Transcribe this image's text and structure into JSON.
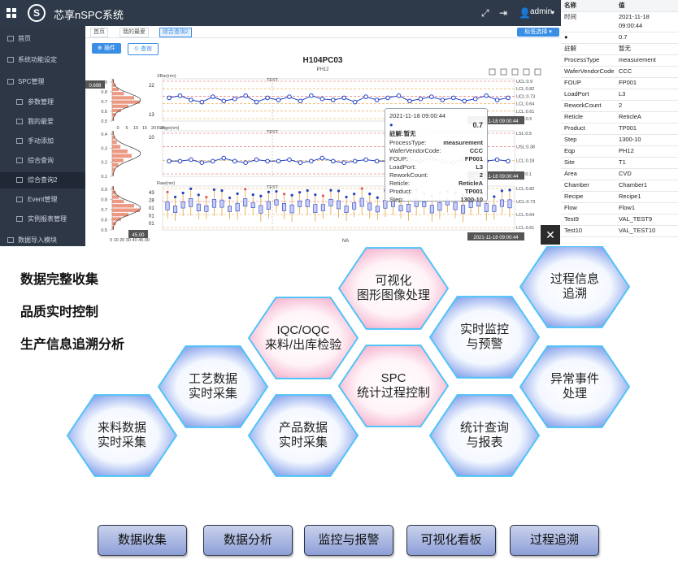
{
  "app": {
    "title": "芯享nSPC系统",
    "user": "admin"
  },
  "sidebar": {
    "items": [
      "首页",
      "系统功能设定",
      "SPC管理",
      "参数管理",
      "我的最爱",
      "手动添加",
      "综合查询",
      "综合查询2",
      "Event管理",
      "实例报表管理",
      "数据导入模块"
    ]
  },
  "tabs": [
    "首页",
    "我的最爱",
    "综合查询2"
  ],
  "tab_select": "标签选择",
  "toolbar": {
    "btn1": "插件",
    "btn2": "查询"
  },
  "chart": {
    "title": "H104PC03",
    "subtitle": "PH12",
    "panels": [
      {
        "ylabel": "XBar(nm)",
        "section": "TEST",
        "ymax": "0.9",
        "ylabels": [
          "0.9",
          "0.8",
          "0.7",
          "0.6",
          "0.5"
        ],
        "hist_labels": [
          "22",
          "13"
        ],
        "limits": [
          "UCL:0.9",
          "LCL:0.82",
          "UCL:0.73",
          "LCL:0.64",
          "LCL:0.61",
          "LCL:0.5"
        ],
        "current": "0.698",
        "values": [
          0.72,
          0.74,
          0.7,
          0.68,
          0.73,
          0.69,
          0.71,
          0.74,
          0.68,
          0.72,
          0.7,
          0.73,
          0.69,
          0.74,
          0.71,
          0.7,
          0.72,
          0.68,
          0.73,
          0.7,
          0.72,
          0.74,
          0.69,
          0.71,
          0.73,
          0.7,
          0.72,
          0.69,
          0.71,
          0.74,
          0.7,
          0.72
        ]
      },
      {
        "ylabel": "Range(nm)",
        "section": "TEST",
        "ylabels": [
          "0.4",
          "0.3",
          "0.2",
          "0.1"
        ],
        "hist_labels": [
          "10"
        ],
        "limits": [
          "LSL:0.5",
          "USL:0.38",
          "LCL:0.18",
          "LSL:0.1"
        ],
        "current": "",
        "values": [
          0.2,
          0.2,
          0.21,
          0.19,
          0.2,
          0.22,
          0.2,
          0.19,
          0.21,
          0.2,
          0.2,
          0.21,
          0.19,
          0.2,
          0.22,
          0.2,
          0.19,
          0.2,
          0.21,
          0.2,
          0.2,
          0.19,
          0.21,
          0.2,
          0.22,
          0.2,
          0.19,
          0.21,
          0.2,
          0.2,
          0.21,
          0.2
        ]
      },
      {
        "ylabel": "Raw(nm)",
        "section": "TEST",
        "ylabels": [
          "0.9",
          "0.8",
          "0.7",
          "0.6",
          "0.5"
        ],
        "hist_labels": [
          "43",
          "28",
          "01",
          "01",
          "01"
        ],
        "limits": [
          "LCL:0.82",
          "UCL:0.73",
          "LCL:0.64",
          "LCL:0.61"
        ],
        "current": "45.00",
        "xlabel": "NA",
        "x_ticks": "0 10 20 30 40 45.00"
      }
    ],
    "top_ticks": [
      "0",
      "5",
      "10",
      "15",
      "20",
      "25"
    ],
    "timestamp": "2021-11-18 09:00:44"
  },
  "tooltip": {
    "time": "2021-11-18 09:00:44",
    "value": "0.7",
    "note": "註解:暂无",
    "rows": [
      {
        "k": "ProcessType:",
        "v": "measurement"
      },
      {
        "k": "WaferVendorCode:",
        "v": "CCC"
      },
      {
        "k": "FOUP:",
        "v": "FP001"
      },
      {
        "k": "LoadPort:",
        "v": "L3"
      },
      {
        "k": "ReworkCount:",
        "v": "2"
      },
      {
        "k": "Reticle:",
        "v": "ReticleA"
      },
      {
        "k": "Product:",
        "v": "TP001"
      },
      {
        "k": "Step:",
        "v": "1300-10"
      }
    ]
  },
  "props": {
    "header": {
      "k": "名称",
      "v": "值"
    },
    "rows": [
      {
        "k": "时间",
        "v": "2021-11-18 09:00:44"
      },
      {
        "k": "●",
        "v": "0.7"
      },
      {
        "k": "註解",
        "v": "暂无"
      },
      {
        "k": "ProcessType",
        "v": "measurement"
      },
      {
        "k": "WaferVendorCode",
        "v": "CCC"
      },
      {
        "k": "FOUP",
        "v": "FP001"
      },
      {
        "k": "LoadPort",
        "v": "L3"
      },
      {
        "k": "ReworkCount",
        "v": "2"
      },
      {
        "k": "Reticle",
        "v": "ReticleA"
      },
      {
        "k": "Product",
        "v": "TP001"
      },
      {
        "k": "Step",
        "v": "1300-10"
      },
      {
        "k": "Eqp",
        "v": "PH12"
      },
      {
        "k": "Site",
        "v": "T1"
      },
      {
        "k": "Area",
        "v": "CVD"
      },
      {
        "k": "Chamber",
        "v": "Chamber1"
      },
      {
        "k": "Recipe",
        "v": "Recipe1"
      },
      {
        "k": "Flow",
        "v": "Flow1"
      },
      {
        "k": "Test9",
        "v": "VAL_TEST9"
      },
      {
        "k": "Test10",
        "v": "VAL_TEST10"
      }
    ]
  },
  "features": [
    "数据完整收集",
    "品质实时控制",
    "生产信息追溯分析"
  ],
  "hexagons": [
    {
      "l1": "可视化",
      "l2": "图形图像处理",
      "fill": "pink"
    },
    {
      "l1": "过程信息",
      "l2": "追溯",
      "fill": "blue"
    },
    {
      "l1": "IQC/OQC",
      "l2": "来料/出库检验",
      "fill": "pink"
    },
    {
      "l1": "实时监控",
      "l2": "与预警",
      "fill": "blue"
    },
    {
      "l1": "工艺数据",
      "l2": "实时采集",
      "fill": "blue"
    },
    {
      "l1": "SPC",
      "l2": "统计过程控制",
      "fill": "pink"
    },
    {
      "l1": "异常事件",
      "l2": "处理",
      "fill": "blue"
    },
    {
      "l1": "来料数据",
      "l2": "实时采集",
      "fill": "blue"
    },
    {
      "l1": "产品数据",
      "l2": "实时采集",
      "fill": "blue"
    },
    {
      "l1": "统计查询",
      "l2": "与报表",
      "fill": "blue"
    }
  ],
  "pills": [
    "数据收集",
    "数据分析",
    "监控与报警",
    "可视化看板",
    "过程追溯"
  ],
  "colors": {
    "accent": "#3a8ee6",
    "topbar": "#2e3a4a",
    "sidebar": "#2d3746",
    "series": "#1f3fc4",
    "limit_red": "#e05a5a",
    "limit_orange": "#e6a23c"
  }
}
